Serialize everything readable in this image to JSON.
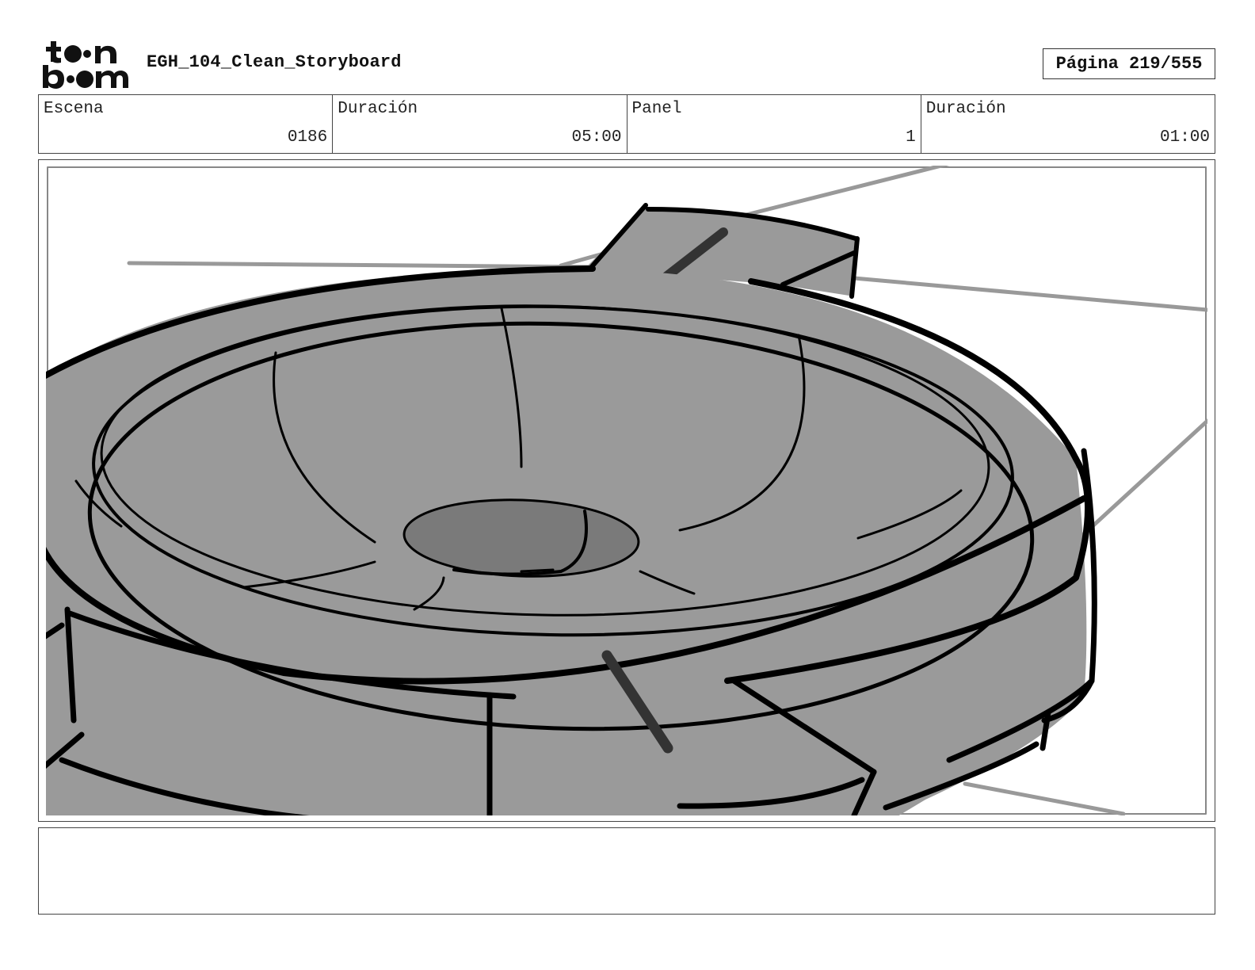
{
  "header": {
    "logo_text": "toon boom",
    "doc_title": "EGH_104_Clean_Storyboard",
    "page_label": "Página 219/555"
  },
  "info": [
    {
      "label": "Escena",
      "value": "0186"
    },
    {
      "label": "Duración",
      "value": "05:00"
    },
    {
      "label": "Panel",
      "value": "1"
    },
    {
      "label": "Duración",
      "value": "01:00"
    }
  ],
  "panel": {
    "icon": "storyboard-sketch-round-bowl",
    "fill_color": "#9a9a9a",
    "hole_color": "#7a7a7a",
    "line_color": "#000000",
    "bg_line_color": "#999999"
  },
  "notes": {
    "text": ""
  }
}
